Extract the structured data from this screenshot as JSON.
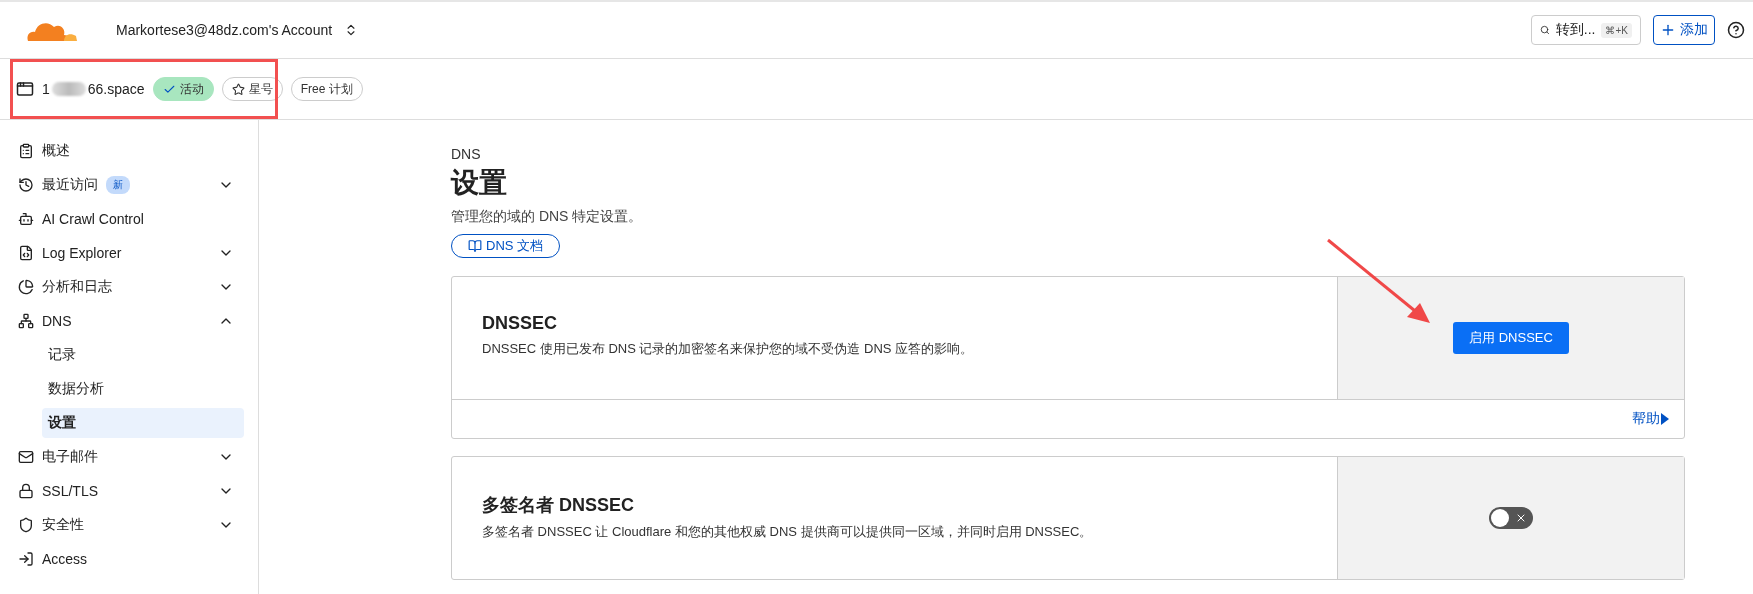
{
  "topbar": {
    "account": "Markortese3@48dz.com's Account",
    "search": {
      "placeholder": "转到...",
      "shortcut": "⌘+K"
    },
    "add_button": "添加"
  },
  "zone": {
    "domain_prefix": "1",
    "domain_suffix": "66.space",
    "status": {
      "label": "活动",
      "active": true
    },
    "star": {
      "label": "星号",
      "starred": false
    },
    "plan": "Free 计划"
  },
  "sidebar": {
    "items": [
      {
        "label": "概述",
        "selected": false
      },
      {
        "label": "最近访问",
        "badge": "新",
        "expanded": false,
        "selected": false
      },
      {
        "label": "AI Crawl Control",
        "selected": false
      },
      {
        "label": "Log Explorer",
        "expanded": false,
        "selected": false
      },
      {
        "label": "分析和日志",
        "expanded": false,
        "selected": false
      },
      {
        "label": "DNS",
        "expanded": true,
        "selected": false,
        "children": [
          {
            "label": "记录",
            "selected": false
          },
          {
            "label": "数据分析",
            "selected": false
          },
          {
            "label": "设置",
            "selected": true
          }
        ]
      },
      {
        "label": "电子邮件",
        "expanded": false,
        "selected": false
      },
      {
        "label": "SSL/TLS",
        "expanded": false,
        "selected": false
      },
      {
        "label": "安全性",
        "expanded": false,
        "selected": false
      },
      {
        "label": "Access",
        "selected": false
      }
    ]
  },
  "page": {
    "eyebrow": "DNS",
    "title": "设置",
    "description": "管理您的域的 DNS 特定设置。",
    "docs_link": "DNS 文档"
  },
  "cards": [
    {
      "kind": "button",
      "title": "DNSSEC",
      "description": "DNSSEC 使用已发布 DNS 记录的加密签名来保护您的域不受伪造 DNS 应答的影响。",
      "action": "启用 DNSSEC",
      "help": "帮助"
    },
    {
      "kind": "toggle",
      "title": "多签名者 DNSSEC",
      "description": "多签名者 DNSSEC 让 Cloudflare 和您的其他权威 DNS 提供商可以提供同一区域，并同时启用 DNSSEC。",
      "on": false
    }
  ]
}
